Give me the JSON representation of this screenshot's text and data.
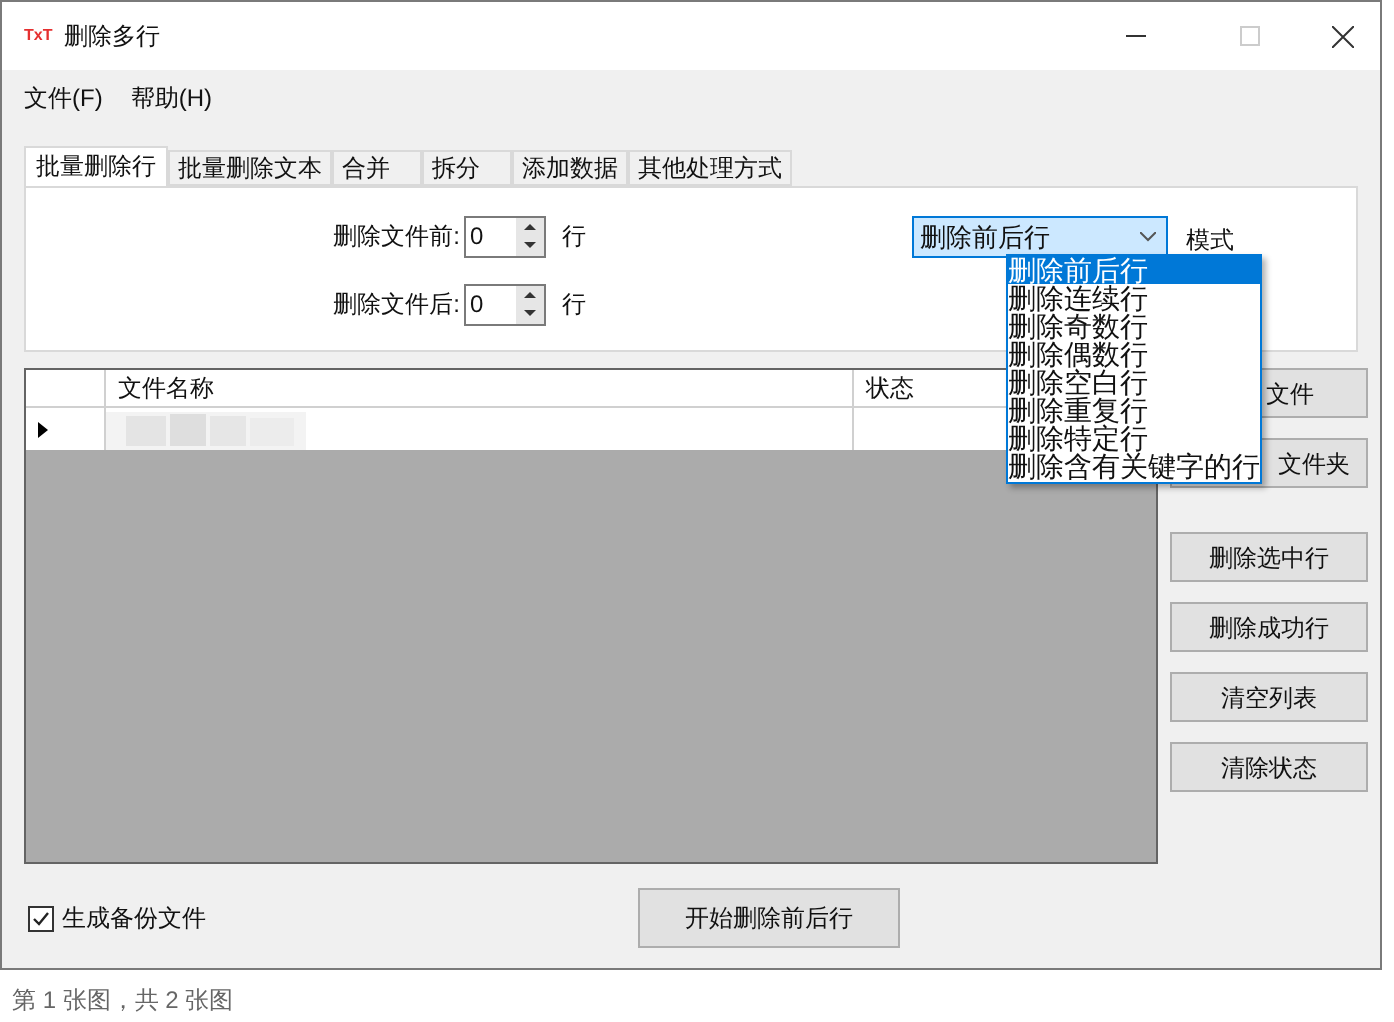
{
  "window": {
    "title": "删除多行",
    "logo": "TxT"
  },
  "menu": [
    "文件(F)",
    "帮助(H)"
  ],
  "tabs": [
    {
      "label": "批量删除行",
      "selected": true
    },
    {
      "label": "批量删除文本",
      "selected": false
    },
    {
      "label": "合并",
      "selected": false
    },
    {
      "label": "拆分",
      "selected": false
    },
    {
      "label": "添加数据",
      "selected": false
    },
    {
      "label": "其他处理方式",
      "selected": false
    }
  ],
  "spinners": [
    {
      "label": "删除文件前:",
      "value": "0",
      "unit": "行"
    },
    {
      "label": "删除文件后:",
      "value": "0",
      "unit": "行"
    }
  ],
  "mode": {
    "value": "删除前后行",
    "label": "模式",
    "expanded": true,
    "options": [
      {
        "label": "删除前后行",
        "selected": true
      },
      {
        "label": "删除连续行",
        "selected": false
      },
      {
        "label": "删除奇数行",
        "selected": false
      },
      {
        "label": "删除偶数行",
        "selected": false
      },
      {
        "label": "删除空白行",
        "selected": false
      },
      {
        "label": "删除重复行",
        "selected": false
      },
      {
        "label": "删除特定行",
        "selected": false
      },
      {
        "label": "删除含有关键字的行",
        "selected": false
      }
    ]
  },
  "table": {
    "columns": [
      "文件名称",
      "状态"
    ],
    "rows": [
      {
        "current": true,
        "kind": "picture"
      }
    ]
  },
  "side_buttons": [
    "文件",
    "文件夹",
    "删除选中行",
    "删除成功行",
    "清空列表",
    "清除状态"
  ],
  "backup": {
    "label": "生成备份文件",
    "checked": true
  },
  "start_button": "开始删除前后行",
  "caption": "第 1 张图，共 2 张图"
}
